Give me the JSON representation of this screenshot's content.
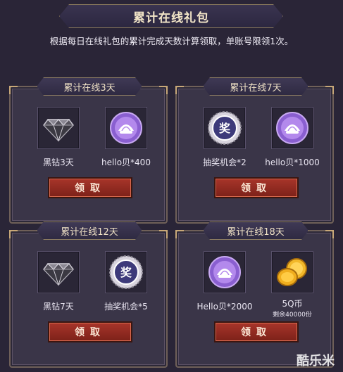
{
  "header": {
    "title": "累计在线礼包"
  },
  "description": "根据每日在线礼包的累计完成天数计算领取，单账号限领1次。",
  "panels": [
    {
      "title": "累计在线3天",
      "items": [
        {
          "icon": "black-diamond-icon",
          "label": "黑钻3天"
        },
        {
          "icon": "hello-shell-icon",
          "label": "hello贝*400"
        }
      ],
      "button": "领取"
    },
    {
      "title": "累计在线7天",
      "items": [
        {
          "icon": "lottery-badge-icon",
          "label": "抽奖机会*2"
        },
        {
          "icon": "hello-shell-icon",
          "label": "hello贝*1000"
        }
      ],
      "button": "领取"
    },
    {
      "title": "累计在线12天",
      "items": [
        {
          "icon": "black-diamond-icon",
          "label": "黑钻7天"
        },
        {
          "icon": "lottery-badge-icon",
          "label": "抽奖机会*5"
        }
      ],
      "button": "领取"
    },
    {
      "title": "累计在线18天",
      "items": [
        {
          "icon": "hello-shell-icon",
          "label": "Hello贝*2000"
        },
        {
          "icon": "q-coin-icon",
          "label": "5Q币",
          "sub": "剩余40000份"
        }
      ],
      "button": "领取"
    }
  ],
  "icons": {
    "diamond_glyph": "◆",
    "lottery_glyph": "奖"
  },
  "watermark": "酷乐米"
}
